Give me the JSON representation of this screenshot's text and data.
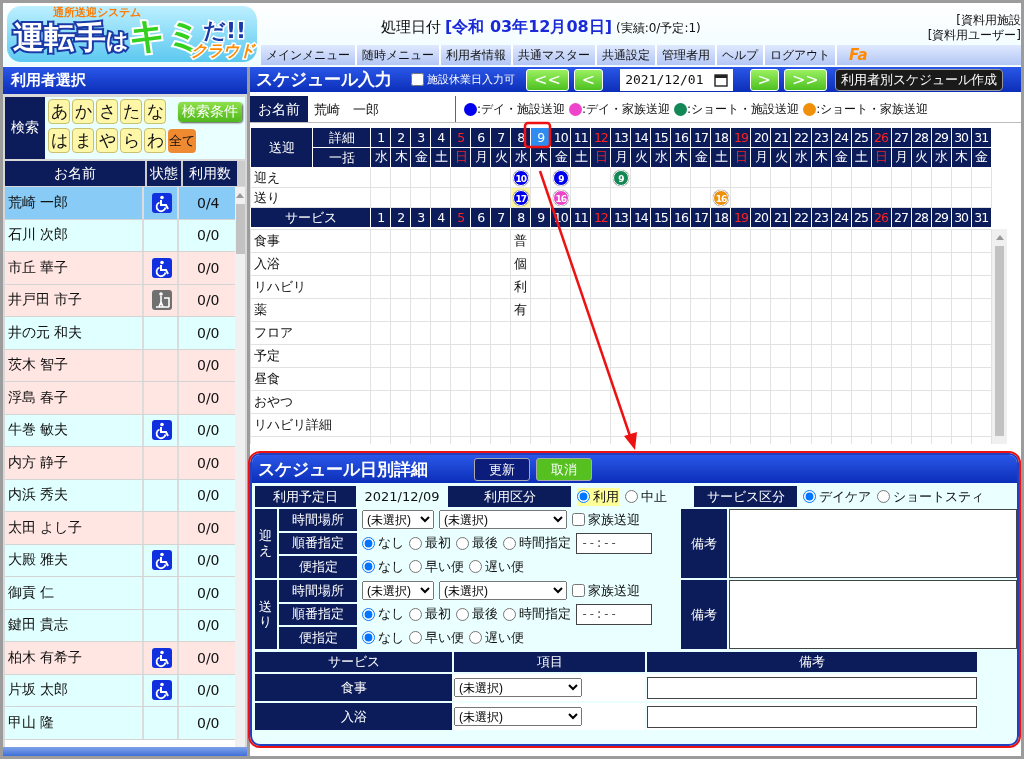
{
  "header": {
    "logo": {
      "tagline": "通所送迎システム",
      "parts": [
        {
          "text": "運転手",
          "kind": "white"
        },
        {
          "text": "は",
          "kind": "small"
        },
        {
          "text": "キミ",
          "kind": "green"
        },
        {
          "text": "だ!!",
          "kind": "dark"
        }
      ],
      "sub": "クラウド"
    },
    "date_label": "処理日付",
    "date_value": "[令和 03年12月08日]",
    "counts": "(実績:0/予定:1)",
    "facility": "[資料用施設",
    "user": "[資料用ユーザー]"
  },
  "menu": {
    "items": [
      "メインメニュー",
      "随時メニュー",
      "利用者情報",
      "共通マスター",
      "共通設定",
      "管理者用",
      "ヘルプ",
      "ログアウト"
    ],
    "faq": "Fa"
  },
  "user_panel": {
    "title": "利用者選択",
    "search_label": "検索",
    "kana_rows": [
      [
        "あ",
        "か",
        "さ",
        "た",
        "な"
      ],
      [
        "は",
        "ま",
        "や",
        "ら",
        "わ"
      ]
    ],
    "all_button": "全て",
    "condition_button": "検索条件",
    "columns": [
      "お名前",
      "状態",
      "利用数"
    ],
    "users": [
      {
        "name": "荒崎 一郎",
        "kind": "wheelchair",
        "count": "0/4",
        "selected": true
      },
      {
        "name": "石川 次郎",
        "kind": "plain",
        "count": "0/0",
        "color": "#e0ffff",
        "selected": false
      },
      {
        "name": "市丘 華子",
        "kind": "wheelchair",
        "count": "0/0",
        "color": "#ffe6e2",
        "selected": false
      },
      {
        "name": "井戸田 市子",
        "kind": "walker",
        "count": "0/0",
        "color": "#ffe6e2",
        "selected": false
      },
      {
        "name": "井の元 和夫",
        "kind": "plain",
        "count": "0/0",
        "color": "#e0ffff",
        "selected": false
      },
      {
        "name": "茨木 智子",
        "kind": "plain",
        "count": "0/0",
        "color": "#ffe6e2",
        "selected": false
      },
      {
        "name": "浮島 春子",
        "kind": "plain",
        "count": "0/0",
        "color": "#ffe6e2",
        "selected": false
      },
      {
        "name": "牛巻 敏夫",
        "kind": "wheelchair",
        "count": "0/0",
        "color": "#e0ffff",
        "selected": false
      },
      {
        "name": "内方 静子",
        "kind": "plain",
        "count": "0/0",
        "color": "#ffe6e2",
        "selected": false
      },
      {
        "name": "内浜 秀夫",
        "kind": "plain",
        "count": "0/0",
        "color": "#e0ffff",
        "selected": false
      },
      {
        "name": "太田 よし子",
        "kind": "plain",
        "count": "0/0",
        "color": "#ffe6e2",
        "selected": false
      },
      {
        "name": "大殿 雅夫",
        "kind": "wheelchair",
        "count": "0/0",
        "color": "#e0ffff",
        "selected": false
      },
      {
        "name": "御貢 仁",
        "kind": "plain",
        "count": "0/0",
        "color": "#e0ffff",
        "selected": false
      },
      {
        "name": "鍵田 貴志",
        "kind": "plain",
        "count": "0/0",
        "color": "#e0ffff",
        "selected": false
      },
      {
        "name": "柏木 有希子",
        "kind": "wheelchair",
        "count": "0/0",
        "color": "#ffe6e2",
        "selected": false
      },
      {
        "name": "片坂 太郎",
        "kind": "wheelchair",
        "count": "0/0",
        "color": "#e0ffff",
        "selected": false
      },
      {
        "name": "甲山 隆",
        "kind": "plain",
        "count": "0/0",
        "color": "#e0ffff",
        "selected": false
      }
    ]
  },
  "schedule": {
    "title": "スケジュール入力",
    "holiday_input": {
      "label": "施設休業日入力可",
      "checked": false
    },
    "prev_buttons": [
      "<<",
      "<"
    ],
    "month": "2021/12/01",
    "next_buttons": [
      ">",
      ">>"
    ],
    "create_button": "利用者別スケジュール作成",
    "name_label": "お名前",
    "user_name": "荒崎　一郎",
    "legend": [
      {
        "label": ":デイ・施設送迎",
        "color": "#0000ee"
      },
      {
        "label": ":デイ・家族送迎",
        "color": "#ee44cc"
      },
      {
        "label": ":ショート・施設送迎",
        "color": "#118855"
      },
      {
        "label": ":ショート・家族送迎",
        "color": "#f0900a"
      }
    ],
    "transport_label": "送迎",
    "detail_label": "詳細",
    "bulk_label": "一括",
    "service_label": "サービス",
    "days": [
      {
        "day": "1",
        "weekday": "水",
        "holiday": false,
        "selected": false
      },
      {
        "day": "2",
        "weekday": "木",
        "holiday": false,
        "selected": false
      },
      {
        "day": "3",
        "weekday": "金",
        "holiday": false,
        "selected": false
      },
      {
        "day": "4",
        "weekday": "土",
        "holiday": false,
        "selected": false
      },
      {
        "day": "5",
        "weekday": "日",
        "holiday": true,
        "selected": false
      },
      {
        "day": "6",
        "weekday": "月",
        "holiday": false,
        "selected": false
      },
      {
        "day": "7",
        "weekday": "火",
        "holiday": false,
        "selected": false
      },
      {
        "day": "8",
        "weekday": "水",
        "holiday": false,
        "selected": false
      },
      {
        "day": "9",
        "weekday": "木",
        "holiday": false,
        "selected": true
      },
      {
        "day": "10",
        "weekday": "金",
        "holiday": false,
        "selected": false
      },
      {
        "day": "11",
        "weekday": "土",
        "holiday": false,
        "selected": false
      },
      {
        "day": "12",
        "weekday": "日",
        "holiday": true,
        "selected": false
      },
      {
        "day": "13",
        "weekday": "月",
        "holiday": false,
        "selected": false
      },
      {
        "day": "14",
        "weekday": "火",
        "holiday": false,
        "selected": false
      },
      {
        "day": "15",
        "weekday": "水",
        "holiday": false,
        "selected": false
      },
      {
        "day": "16",
        "weekday": "木",
        "holiday": false,
        "selected": false
      },
      {
        "day": "17",
        "weekday": "金",
        "holiday": false,
        "selected": false
      },
      {
        "day": "18",
        "weekday": "土",
        "holiday": false,
        "selected": false
      },
      {
        "day": "19",
        "weekday": "日",
        "holiday": true,
        "selected": false
      },
      {
        "day": "20",
        "weekday": "月",
        "holiday": false,
        "selected": false
      },
      {
        "day": "21",
        "weekday": "火",
        "holiday": false,
        "selected": false
      },
      {
        "day": "22",
        "weekday": "水",
        "holiday": false,
        "selected": false
      },
      {
        "day": "23",
        "weekday": "木",
        "holiday": false,
        "selected": false
      },
      {
        "day": "24",
        "weekday": "金",
        "holiday": false,
        "selected": false
      },
      {
        "day": "25",
        "weekday": "土",
        "holiday": false,
        "selected": false
      },
      {
        "day": "26",
        "weekday": "日",
        "holiday": true,
        "selected": false
      },
      {
        "day": "27",
        "weekday": "月",
        "holiday": false,
        "selected": false
      },
      {
        "day": "28",
        "weekday": "火",
        "holiday": false,
        "selected": false
      },
      {
        "day": "29",
        "weekday": "水",
        "holiday": false,
        "selected": false
      },
      {
        "day": "30",
        "weekday": "木",
        "holiday": false,
        "selected": false
      },
      {
        "day": "31",
        "weekday": "金",
        "holiday": false,
        "selected": false
      }
    ],
    "transport_rows": [
      {
        "label": "迎え",
        "cells": [
          null,
          null,
          null,
          null,
          null,
          null,
          null,
          {
            "text": "10",
            "color": "#0000ee",
            "highlight": false
          },
          null,
          {
            "text": "9",
            "color": "#0000ee",
            "highlight": false
          },
          null,
          null,
          {
            "text": "9",
            "color": "#118855",
            "highlight": false
          },
          null,
          null,
          null,
          null,
          null,
          null,
          null,
          null,
          null,
          null,
          null,
          null,
          null,
          null,
          null,
          null,
          null,
          null
        ]
      },
      {
        "label": "送り",
        "cells": [
          null,
          null,
          null,
          null,
          null,
          null,
          null,
          {
            "text": "17",
            "color": "#0000ee",
            "highlight": true
          },
          null,
          {
            "text": "16",
            "color": "#ee44cc",
            "highlight": false
          },
          null,
          null,
          null,
          null,
          null,
          null,
          null,
          {
            "text": "16",
            "color": "#f0900a",
            "highlight": false
          },
          null,
          null,
          null,
          null,
          null,
          null,
          null,
          null,
          null,
          null,
          null,
          null,
          null
        ]
      }
    ],
    "service_days": [
      {
        "day": "1",
        "holiday": false
      },
      {
        "day": "2",
        "holiday": false
      },
      {
        "day": "3",
        "holiday": false
      },
      {
        "day": "4",
        "holiday": false
      },
      {
        "day": "5",
        "holiday": true
      },
      {
        "day": "6",
        "holiday": false
      },
      {
        "day": "7",
        "holiday": false
      },
      {
        "day": "8",
        "holiday": false
      },
      {
        "day": "9",
        "holiday": false
      },
      {
        "day": "10",
        "holiday": false
      },
      {
        "day": "11",
        "holiday": false
      },
      {
        "day": "12",
        "holiday": true
      },
      {
        "day": "13",
        "holiday": false
      },
      {
        "day": "14",
        "holiday": false
      },
      {
        "day": "15",
        "holiday": false
      },
      {
        "day": "16",
        "holiday": false
      },
      {
        "day": "17",
        "holiday": false
      },
      {
        "day": "18",
        "holiday": false
      },
      {
        "day": "19",
        "holiday": true
      },
      {
        "day": "20",
        "holiday": false
      },
      {
        "day": "21",
        "holiday": false
      },
      {
        "day": "22",
        "holiday": false
      },
      {
        "day": "23",
        "holiday": false
      },
      {
        "day": "24",
        "holiday": false
      },
      {
        "day": "25",
        "holiday": false
      },
      {
        "day": "26",
        "holiday": true
      },
      {
        "day": "27",
        "holiday": false
      },
      {
        "day": "28",
        "holiday": false
      },
      {
        "day": "29",
        "holiday": false
      },
      {
        "day": "30",
        "holiday": false
      },
      {
        "day": "31",
        "holiday": false
      }
    ],
    "service_rows": [
      {
        "label": "食事",
        "cells": [
          null,
          null,
          null,
          null,
          null,
          null,
          null,
          "普"
        ]
      },
      {
        "label": "入浴",
        "cells": [
          null,
          null,
          null,
          null,
          null,
          null,
          null,
          "個"
        ]
      },
      {
        "label": "リハビリ",
        "cells": [
          null,
          null,
          null,
          null,
          null,
          null,
          null,
          "利"
        ]
      },
      {
        "label": "薬",
        "cells": [
          null,
          null,
          null,
          null,
          null,
          null,
          null,
          "有"
        ]
      },
      {
        "label": "フロア"
      },
      {
        "label": "予定"
      },
      {
        "label": "昼食"
      },
      {
        "label": "おやつ"
      },
      {
        "label": "リハビリ詳細"
      }
    ]
  },
  "detail": {
    "title": "スケジュール日別詳細",
    "buttons": [
      {
        "label": "更新",
        "kind": "primary"
      },
      {
        "label": "取消",
        "kind": "cancel"
      }
    ],
    "date_label": "利用予定日",
    "date_value": "2021/12/09",
    "usage_label": "利用区分",
    "usage_options": [
      {
        "label": "利用",
        "selected": true
      },
      {
        "label": "中止",
        "selected": false
      }
    ],
    "service_type_label": "サービス区分",
    "service_type_options": [
      {
        "label": "デイケア",
        "selected": true
      },
      {
        "label": "ショートスティ",
        "selected": false
      }
    ],
    "transport": [
      {
        "label": "迎え",
        "place_label": "時間場所",
        "selects": [
          "(未選択)",
          "(未選択)"
        ],
        "family": {
          "label": "家族送迎",
          "checked": false
        },
        "order_label": "順番指定",
        "order_options": [
          {
            "label": "なし",
            "selected": true
          },
          {
            "label": "最初",
            "selected": false
          },
          {
            "label": "最後",
            "selected": false
          },
          {
            "label": "時間指定",
            "selected": false
          }
        ],
        "time_value": "--:--",
        "bin_label": "便指定",
        "bin_options": [
          {
            "label": "なし",
            "selected": true
          },
          {
            "label": "早い便",
            "selected": false
          },
          {
            "label": "遅い便",
            "selected": false
          }
        ],
        "note_label": "備考"
      },
      {
        "label": "送り",
        "place_label": "時間場所",
        "selects": [
          "(未選択)",
          "(未選択)"
        ],
        "family": {
          "label": "家族送迎",
          "checked": false
        },
        "order_label": "順番指定",
        "order_options": [
          {
            "label": "なし",
            "selected": true
          },
          {
            "label": "最初",
            "selected": false
          },
          {
            "label": "最後",
            "selected": false
          },
          {
            "label": "時間指定",
            "selected": false
          }
        ],
        "time_value": "--:--",
        "bin_label": "便指定",
        "bin_options": [
          {
            "label": "なし",
            "selected": true
          },
          {
            "label": "早い便",
            "selected": false
          },
          {
            "label": "遅い便",
            "selected": false
          }
        ],
        "note_label": "備考"
      }
    ],
    "service_columns": [
      "サービス",
      "項目",
      "備考"
    ],
    "services": [
      {
        "label": "食事",
        "value": "(未選択)"
      },
      {
        "label": "入浴",
        "value": "(未選択)"
      }
    ]
  }
}
